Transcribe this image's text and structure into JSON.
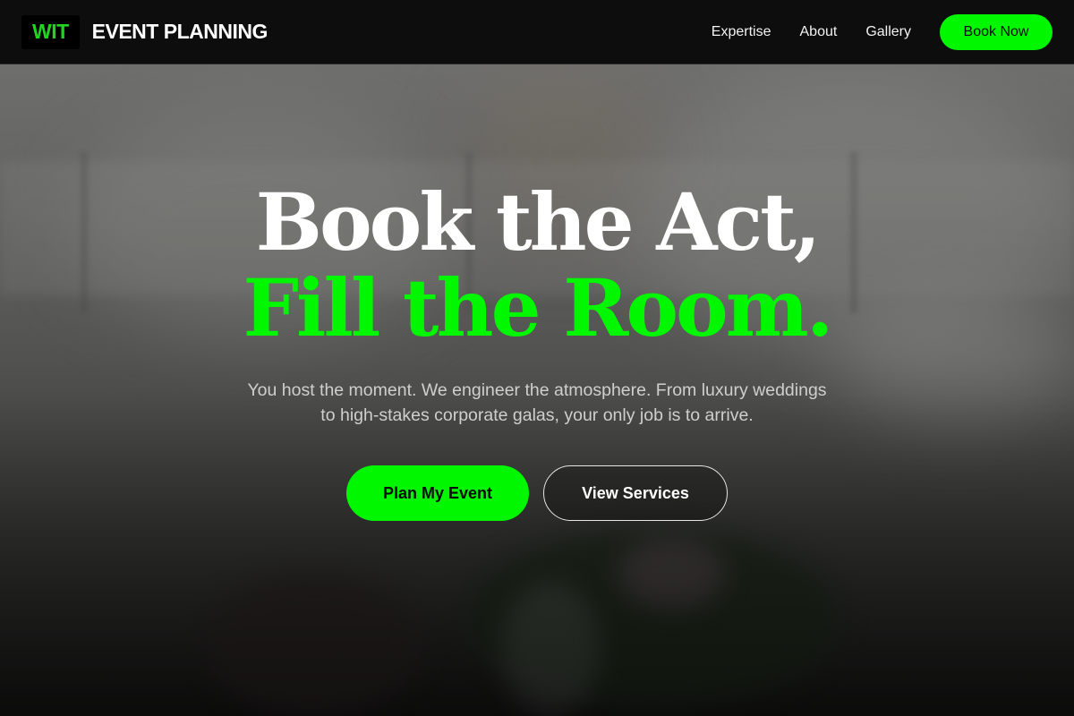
{
  "brand": {
    "mark": "WIT",
    "name": "EVENT PLANNING"
  },
  "nav": {
    "links": [
      "Expertise",
      "About",
      "Gallery"
    ],
    "cta_label": "Book Now"
  },
  "hero": {
    "headline_line1": "Book the Act,",
    "headline_line2": "Fill the Room.",
    "subtitle": "You host the moment. We engineer the atmosphere. From luxury weddings to high-stakes corporate galas, your only job is to arrive.",
    "primary_cta": "Plan My Event",
    "secondary_cta": "View Services"
  },
  "colors": {
    "accent": "#00f700",
    "navbar_bg": "#0d0d0d",
    "text_primary": "#ffffff",
    "text_muted": "#cfcfcf"
  }
}
